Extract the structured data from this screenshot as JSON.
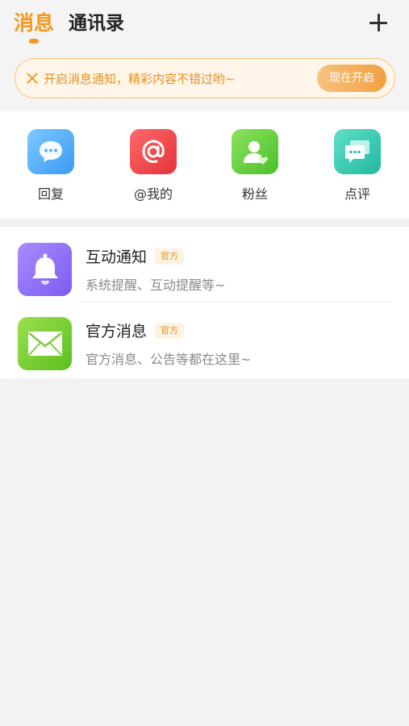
{
  "header": {
    "tabs": [
      {
        "label": "消息",
        "active": true
      },
      {
        "label": "通讯录",
        "active": false
      }
    ],
    "add_icon": "plus-icon"
  },
  "banner": {
    "text": "开启消息通知，精彩内容不错过哟~",
    "button_label": "现在开启",
    "close_icon": "close-icon"
  },
  "quick_actions": [
    {
      "label": "回复",
      "icon": "chat-bubble-icon"
    },
    {
      "label": "@我的",
      "icon": "at-sign-icon"
    },
    {
      "label": "粉丝",
      "icon": "user-heart-icon"
    },
    {
      "label": "点评",
      "icon": "comment-icon"
    }
  ],
  "messages": [
    {
      "title": "互动通知",
      "badge": "官方",
      "subtitle": "系统提醒、互动提醒等~",
      "icon": "bell-icon"
    },
    {
      "title": "官方消息",
      "badge": "官方",
      "subtitle": "官方消息、公告等都在这里~",
      "icon": "envelope-icon"
    }
  ],
  "colors": {
    "accent": "#f39a1e",
    "background": "#f2f2f2"
  }
}
